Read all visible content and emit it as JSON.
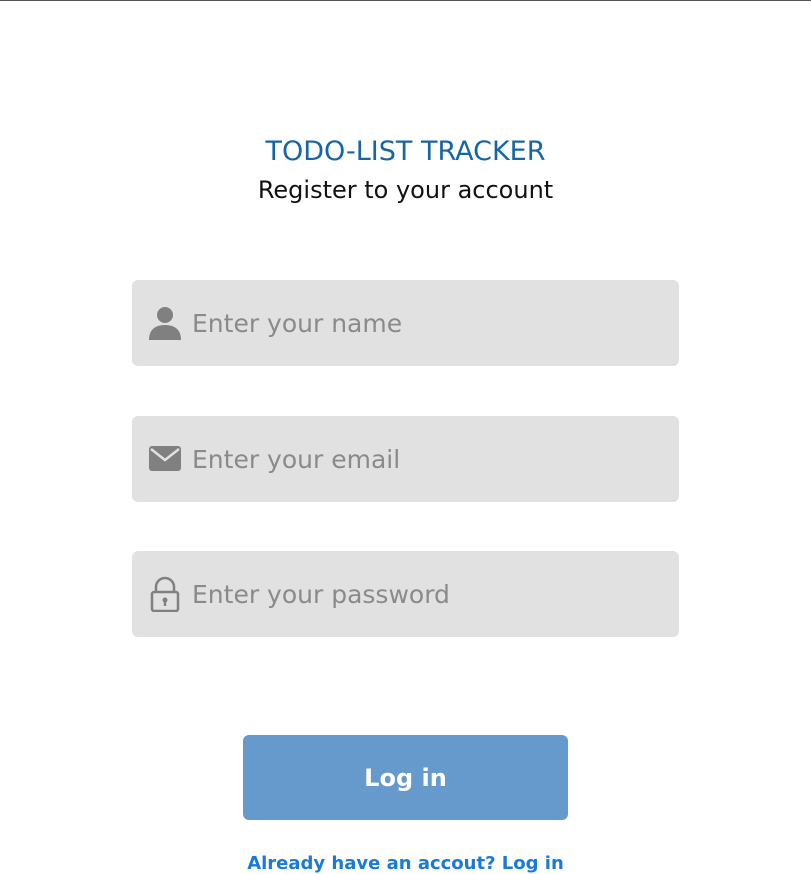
{
  "header": {
    "app_title": "TODO-LIST TRACKER",
    "subtitle": "Register to your account"
  },
  "form": {
    "name_field": {
      "placeholder": "Enter your name",
      "value": "",
      "icon": "user-icon"
    },
    "email_field": {
      "placeholder": "Enter your email",
      "value": "",
      "icon": "envelope-icon"
    },
    "password_field": {
      "placeholder": "Enter your password",
      "value": "",
      "icon": "lock-icon"
    },
    "submit_label": "Log in"
  },
  "footer": {
    "login_link": "Already have an accout? Log in"
  },
  "colors": {
    "title": "#1565a8",
    "field_background": "#e1e1e1",
    "icon": "#808080",
    "button": "#6699cc",
    "link": "#1a7bd6"
  }
}
